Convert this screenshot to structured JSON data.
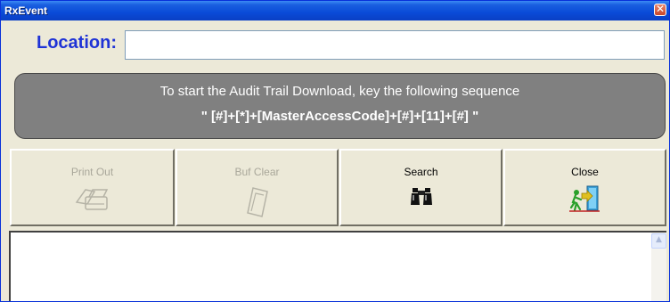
{
  "window": {
    "title": "RxEvent",
    "close_glyph": "✕"
  },
  "location": {
    "label": "Location:",
    "value": ""
  },
  "banner": {
    "line1": "To start the Audit Trail Download, key the following sequence",
    "line2": "\" [#]+[*]+[MasterAccessCode]+[#]+[11]+[#] \""
  },
  "buttons": [
    {
      "label": "Print Out",
      "icon": "printer-icon",
      "enabled": false
    },
    {
      "label": "Buf Clear",
      "icon": "eraser-icon",
      "enabled": false
    },
    {
      "label": "Search",
      "icon": "binoculars-icon",
      "enabled": true
    },
    {
      "label": "Close",
      "icon": "exit-door-icon",
      "enabled": true
    }
  ],
  "log": {
    "text": ""
  },
  "scrollbar": {
    "up_glyph": "▲"
  },
  "colors": {
    "title_bar": "#0a4bd8",
    "label_blue": "#1f33d6",
    "banner_bg": "#808080",
    "window_bg": "#ece9d8"
  }
}
